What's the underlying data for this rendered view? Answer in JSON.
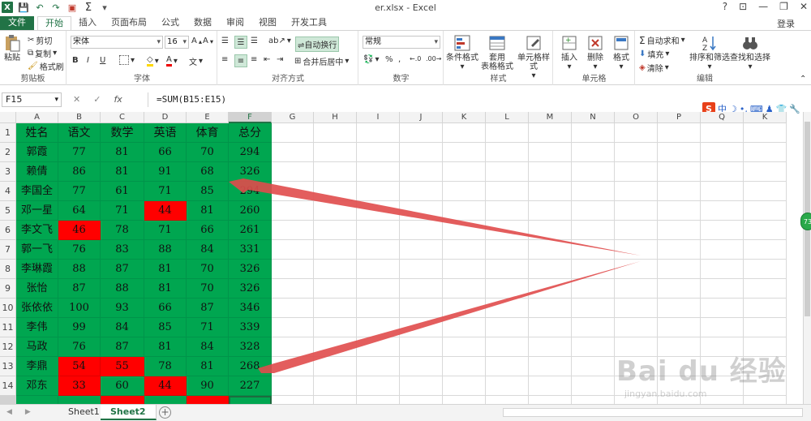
{
  "window": {
    "title": "er.xlsx - Excel",
    "login": "登录",
    "controls": [
      "?",
      "❐",
      "—",
      "❐",
      "✕"
    ]
  },
  "ribbon_tabs": [
    "文件",
    "开始",
    "插入",
    "页面布局",
    "公式",
    "数据",
    "审阅",
    "视图",
    "开发工具"
  ],
  "ribbon": {
    "clipboard": {
      "label": "剪贴板",
      "paste": "粘贴",
      "cut": "剪切",
      "copy": "复制",
      "format_painter": "格式刷"
    },
    "font": {
      "label": "字体",
      "name": "宋体",
      "size": "16",
      "bold": "B",
      "italic": "I",
      "underline": "U"
    },
    "alignment": {
      "label": "对齐方式",
      "wrap": "自动换行",
      "merge": "合并后居中"
    },
    "number": {
      "label": "数字",
      "format": "常规",
      "percent": "%"
    },
    "styles": {
      "label": "样式",
      "conditional": "条件格式",
      "table": "套用\n表格格式",
      "cell_styles": "单元格样式"
    },
    "cells": {
      "label": "单元格",
      "insert": "插入",
      "delete": "删除",
      "format": "格式"
    },
    "editing": {
      "label": "编辑",
      "autosum": "自动求和",
      "fill": "填充",
      "clear": "清除",
      "sort": "排序和筛选",
      "find": "查找和选择"
    }
  },
  "formula_bar": {
    "name_box": "F15",
    "formula": "=SUM(B15:E15)",
    "fx": "fx"
  },
  "ime": {
    "logo": "S",
    "items": [
      "中",
      "☽",
      "•,",
      "⌨",
      "♟",
      "👕",
      "🔧"
    ]
  },
  "columns": [
    "A",
    "B",
    "C",
    "D",
    "E",
    "F",
    "G",
    "H",
    "I",
    "J",
    "K",
    "L",
    "M",
    "N",
    "O",
    "P",
    "Q",
    "K"
  ],
  "selected_column": "F",
  "rows": [
    "1",
    "2",
    "3",
    "4",
    "5",
    "6",
    "7",
    "8",
    "9",
    "10",
    "11",
    "12",
    "13",
    "14"
  ],
  "table": {
    "headers": [
      "姓名",
      "语文",
      "数学",
      "英语",
      "体育",
      "总分"
    ],
    "data": [
      [
        "郭霞",
        "77",
        "81",
        "66",
        "70",
        "294"
      ],
      [
        "赖倩",
        "86",
        "81",
        "91",
        "68",
        "326"
      ],
      [
        "李国全",
        "77",
        "61",
        "71",
        "85",
        "294"
      ],
      [
        "邓一星",
        "64",
        "71",
        "44",
        "81",
        "260"
      ],
      [
        "李文飞",
        "46",
        "78",
        "71",
        "66",
        "261"
      ],
      [
        "郭一飞",
        "76",
        "83",
        "88",
        "84",
        "331"
      ],
      [
        "李琳霞",
        "88",
        "87",
        "81",
        "70",
        "326"
      ],
      [
        "张怡",
        "87",
        "88",
        "81",
        "70",
        "326"
      ],
      [
        "张依依",
        "100",
        "93",
        "66",
        "87",
        "346"
      ],
      [
        "李伟",
        "99",
        "84",
        "85",
        "71",
        "339"
      ],
      [
        "马政",
        "76",
        "87",
        "81",
        "84",
        "328"
      ],
      [
        "李鼎",
        "54",
        "55",
        "78",
        "81",
        "268"
      ],
      [
        "邓东",
        "33",
        "60",
        "44",
        "90",
        "227"
      ]
    ]
  },
  "highlight_colors": {
    "pass": "#00a650",
    "fail": "#ff0000"
  },
  "sheets": [
    "Sheet1",
    "Sheet2"
  ],
  "active_sheet": "Sheet2",
  "vertical_scroll_badge": "73",
  "watermark": {
    "main": "Bai du 经验",
    "sub": "jingyan.baidu.com"
  }
}
